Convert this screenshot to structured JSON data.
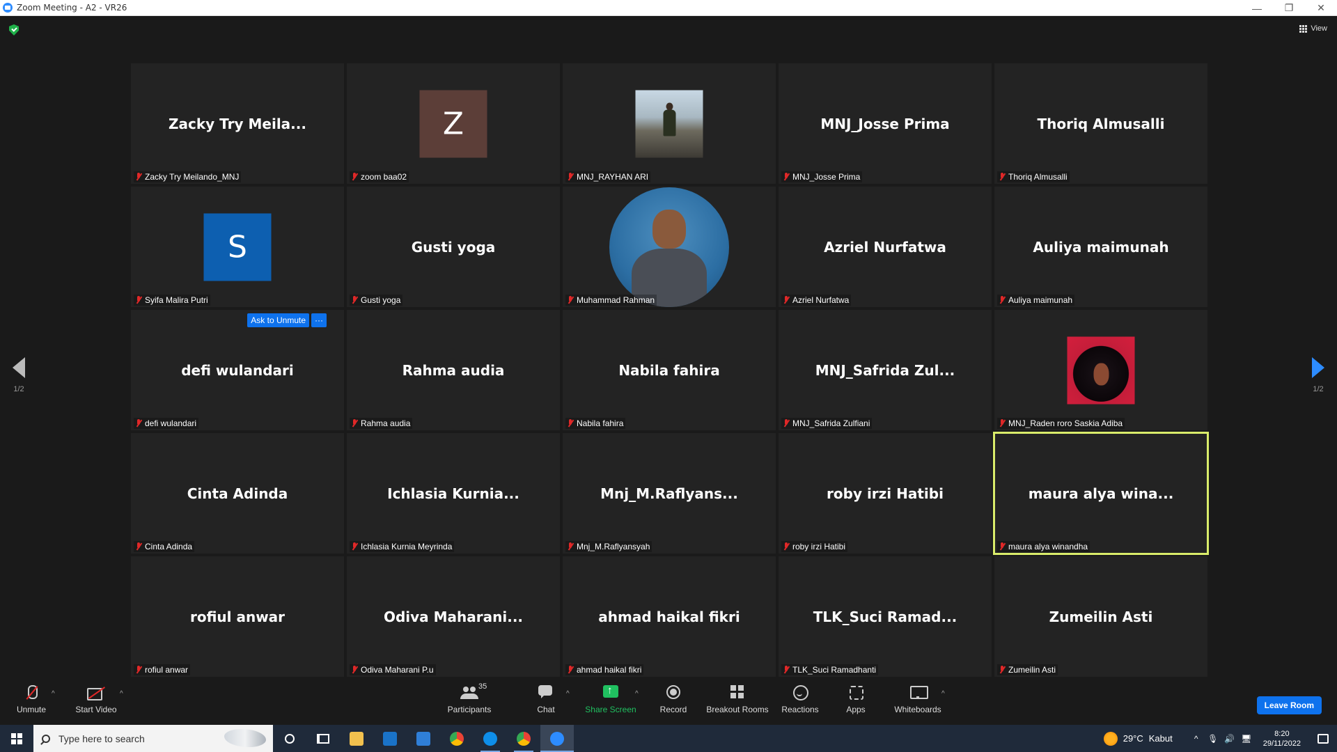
{
  "window": {
    "title": "Zoom Meeting - A2 - VR26",
    "minimize": "—",
    "restore": "❐",
    "close": "✕"
  },
  "header": {
    "view_label": "View"
  },
  "pager": {
    "left_page": "1/2",
    "right_page": "1/2"
  },
  "tiles": [
    {
      "big_name": "Zacky  Try  Meila...",
      "label": "Zacky Try Meilando_MNJ",
      "muted": true
    },
    {
      "avatar_letter": "Z",
      "avatar_color": "#5c3e38",
      "label": "zoom baa02",
      "muted": true
    },
    {
      "avatar_photo": "walking-person-photo",
      "label": "MNJ_RAYHAN ARI",
      "muted": true
    },
    {
      "big_name": "MNJ_Josse Prima",
      "label": "MNJ_Josse Prima",
      "muted": true
    },
    {
      "big_name": "Thoriq Almusalli",
      "label": "Thoriq Almusalli",
      "muted": true
    },
    {
      "avatar_letter": "S",
      "avatar_color": "#0d5fb0",
      "label": "Syifa Malira Putri",
      "muted": true
    },
    {
      "big_name": "Gusti yoga",
      "label": "Gusti yoga",
      "muted": true
    },
    {
      "avatar_photo": "portrait-circle-photo",
      "label": "Muhammad Rahman",
      "muted": true
    },
    {
      "big_name": "Azriel Nurfatwa",
      "label": "Azriel Nurfatwa",
      "muted": true
    },
    {
      "big_name": "Auliya maimunah",
      "label": "Auliya maimunah",
      "muted": true
    },
    {
      "big_name": "defi wulandari",
      "label": "defi wulandari",
      "muted": true,
      "ask_unmute": "Ask to Unmute",
      "more": "···"
    },
    {
      "big_name": "Rahma audia",
      "label": "Rahma audia",
      "muted": true
    },
    {
      "big_name": "Nabila fahira",
      "label": "Nabila fahira",
      "muted": true
    },
    {
      "big_name": "MNJ_Safrida  Zul...",
      "label": "MNJ_Safrida Zulfiani",
      "muted": true
    },
    {
      "avatar_photo": "illustrated-woman-photo",
      "label": "MNJ_Raden roro Saskia Adiba",
      "muted": true
    },
    {
      "big_name": "Cinta Adinda",
      "label": "Cinta Adinda",
      "muted": true
    },
    {
      "big_name": "Ichlasia  Kurnia...",
      "label": "Ichlasia Kurnia Meyrinda",
      "muted": true
    },
    {
      "big_name": "Mnj_M.Raflyans...",
      "label": "Mnj_M.Raflyansyah",
      "muted": true
    },
    {
      "big_name": "roby irzi Hatibi",
      "label": "roby irzi Hatibi",
      "muted": true
    },
    {
      "big_name": "maura  alya  wina...",
      "label": "maura alya winandha",
      "muted": true,
      "active_speaker": true
    },
    {
      "big_name": "rofiul anwar",
      "label": "rofiul anwar",
      "muted": true
    },
    {
      "big_name": "Odiva  Maharani...",
      "label": "Odiva Maharani P.u",
      "muted": true
    },
    {
      "big_name": "ahmad haikal fikri",
      "label": "ahmad haikal fikri",
      "muted": true
    },
    {
      "big_name": "TLK_Suci  Ramad...",
      "label": "TLK_Suci Ramadhanti",
      "muted": true
    },
    {
      "big_name": "Zumeilin Asti",
      "label": "Zumeilin Asti",
      "muted": true
    }
  ],
  "toolbar": {
    "unmute": "Unmute",
    "start_video": "Start Video",
    "participants": "Participants",
    "participants_count": "35",
    "chat": "Chat",
    "share_screen": "Share Screen",
    "record": "Record",
    "breakout_rooms": "Breakout Rooms",
    "reactions": "Reactions",
    "apps": "Apps",
    "whiteboards": "Whiteboards",
    "leave_room": "Leave Room",
    "caret": "^"
  },
  "taskbar": {
    "search_placeholder": "Type here to search",
    "weather_temp": "29°C",
    "weather_desc": "Kabut",
    "time": "8:20",
    "date": "29/11/2022",
    "tray_up": "^",
    "tray_mic": "🎙",
    "tray_volume": "🔊",
    "tray_network": "🖥"
  },
  "colors": {
    "active_speaker_border": "#d9ec6a",
    "accent_blue": "#0e72ed",
    "share_green": "#20c060",
    "muted_red": "#e02828"
  }
}
